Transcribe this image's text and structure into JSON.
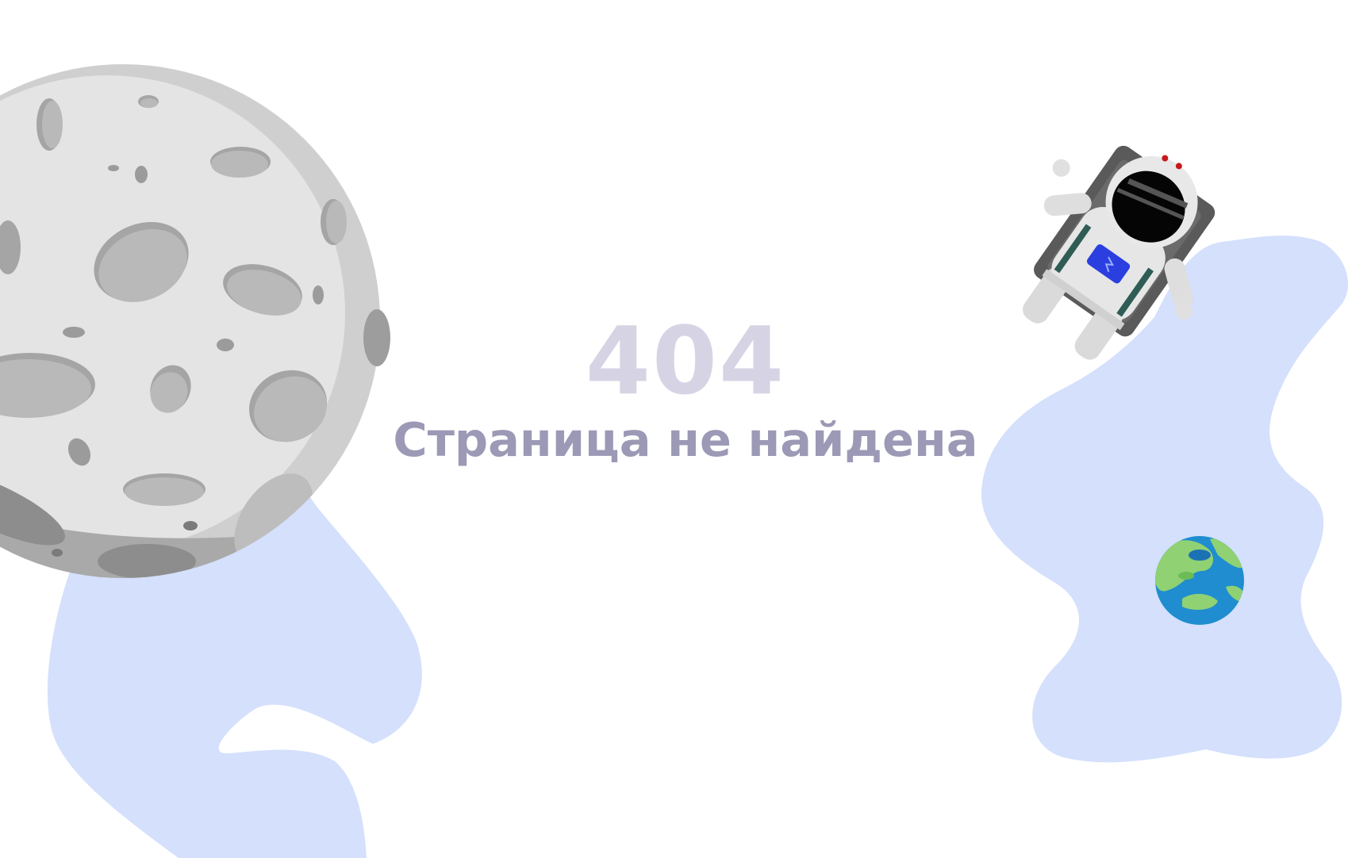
{
  "error": {
    "code": "404",
    "message": "Страница не найдена"
  },
  "illustration": {
    "items": [
      "moon-illustration",
      "astronaut-illustration",
      "earth-illustration"
    ],
    "colors": {
      "blob": "#d4e0fc",
      "moon_light": "#e2e2e2",
      "moon_shadow": "#a9a9a9",
      "crater": "#b7b7b7",
      "earth_ocean": "#1f8dcf",
      "earth_land": "#8fd173",
      "code_text": "#d6d4e4",
      "message_text": "#9b99b5"
    }
  }
}
